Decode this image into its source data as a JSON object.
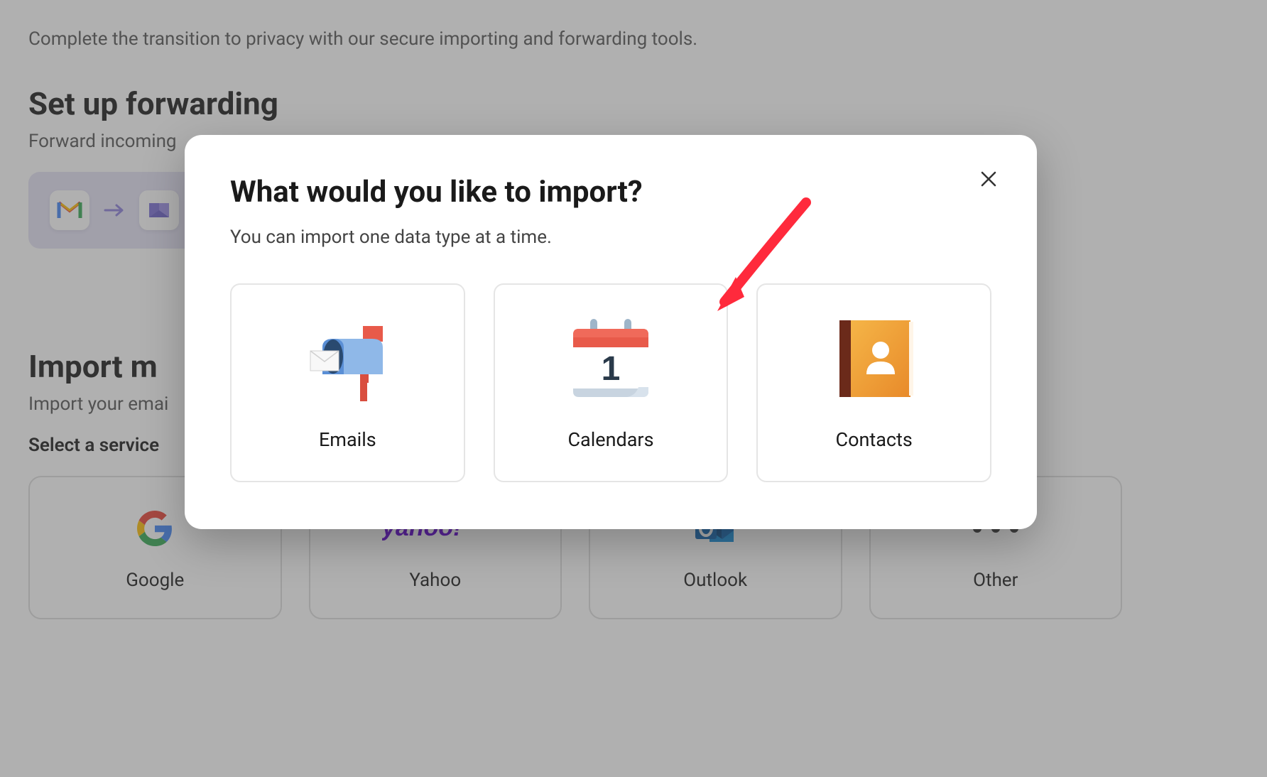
{
  "background": {
    "intro": "Complete the transition to privacy with our secure importing and forwarding tools.",
    "forwarding": {
      "heading": "Set up forwarding",
      "subtitle": "Forward incoming"
    },
    "import": {
      "heading": "Import m",
      "subtitle": "Import your emai",
      "select_label": "Select a service"
    },
    "services": [
      {
        "label": "Google"
      },
      {
        "label": "Yahoo"
      },
      {
        "label": "Outlook"
      },
      {
        "label": "Other"
      }
    ]
  },
  "modal": {
    "title": "What would you like to import?",
    "subtitle": "You can import one data type at a time.",
    "options": [
      {
        "label": "Emails"
      },
      {
        "label": "Calendars"
      },
      {
        "label": "Contacts"
      }
    ]
  }
}
